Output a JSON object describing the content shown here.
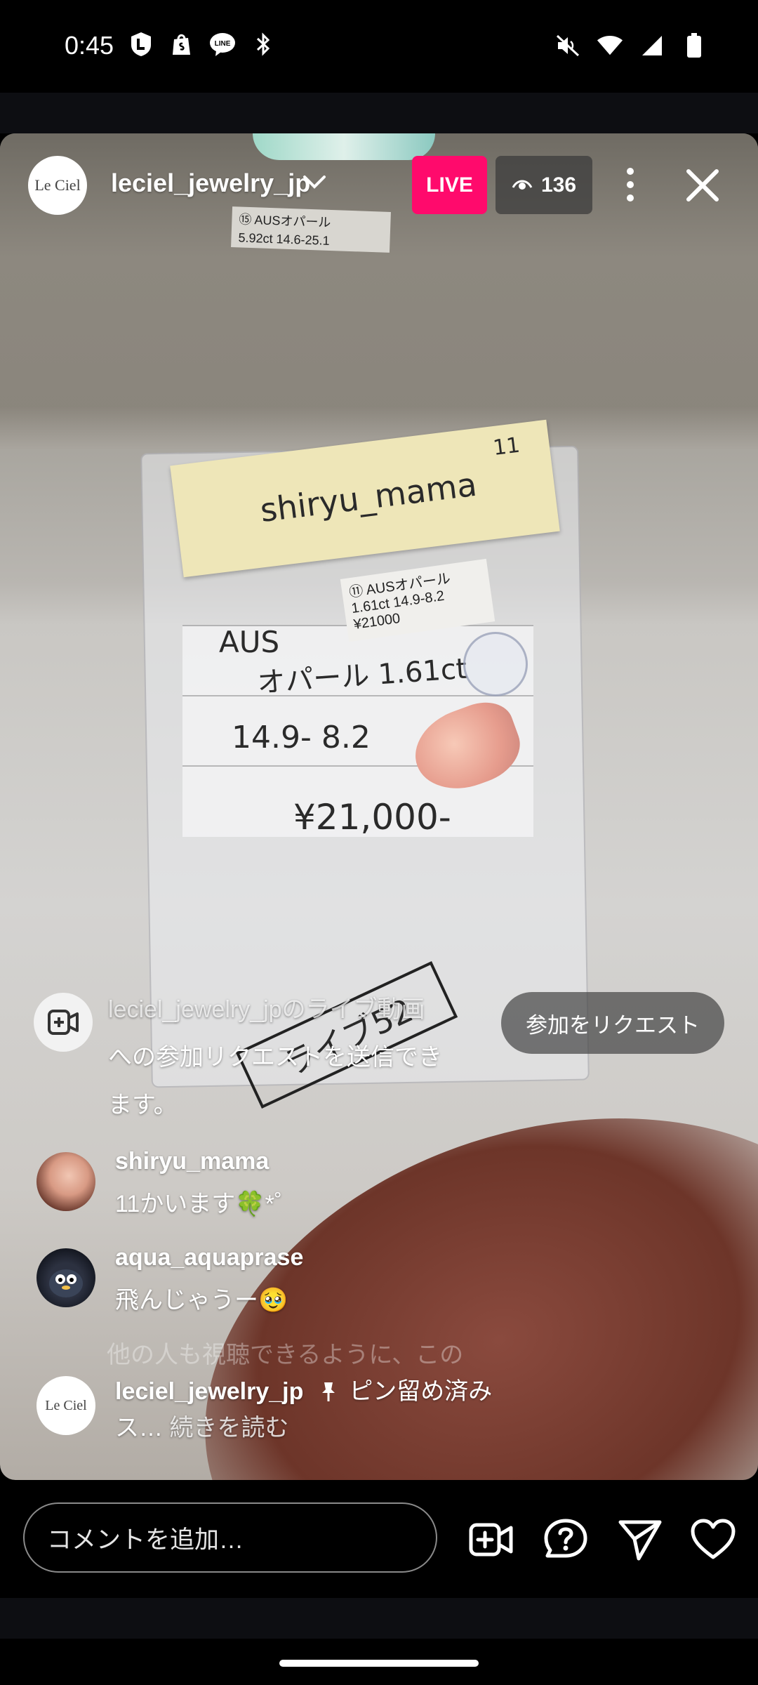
{
  "status_bar": {
    "time": "0:45",
    "left_icons": [
      "l-app-icon",
      "shopify-icon",
      "line-icon",
      "bluetooth-icon"
    ],
    "right_icons": [
      "mute-icon",
      "wifi-icon",
      "signal-icon",
      "battery-icon"
    ]
  },
  "header": {
    "host_avatar_text": "Le Ciel",
    "host_name": "leciel_jewelry_jp",
    "live_label": "LIVE",
    "viewer_count": "136"
  },
  "video_text": {
    "sticky_note": "shiryu_mama",
    "sticky_number": "11",
    "top_label_line1": "⑮ AUSオパール",
    "top_label_line2": "5.92ct 14.6-25.1",
    "card_line1": "⑪ AUSオパール",
    "card_line2": "1.61ct 14.9-8.2",
    "card_line3": "¥21000",
    "hand_line1": "AUS",
    "hand_line2": "オパール 1.61ct",
    "hand_line3": "14.9- 8.2",
    "hand_line4": "¥21,000-",
    "box_label": "ライブ52"
  },
  "system_message": {
    "line1": "leciel_jewelry_jpのライブ動画",
    "line2": "への参加リクエストを送信でき",
    "line3": "ます。",
    "request_button": "参加をリクエスト"
  },
  "comments": [
    {
      "user": "shiryu_mama",
      "text": "11かいます🍀*゜"
    },
    {
      "user": "aqua_aquaprase",
      "text": "飛んじゃうー🥹"
    }
  ],
  "faded_comment": "他の人も視聴できるように、この",
  "pinned": {
    "user": "leciel_jewelry_jp",
    "pin_label": "ピン留め済み",
    "text": "ス…",
    "read_more": "続きを読む"
  },
  "bottom_bar": {
    "comment_placeholder": "コメントを追加…"
  }
}
